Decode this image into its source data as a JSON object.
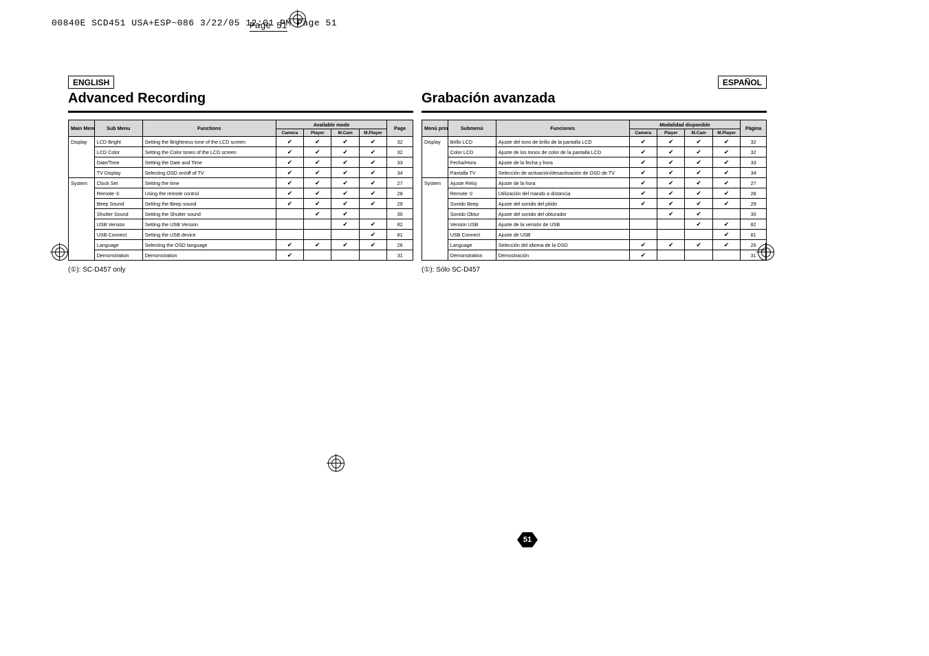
{
  "print_header": "00840E SCD451 USA+ESP~086  3/22/05 12:01 PM  Page 51",
  "page_label": "Page 51",
  "page_number": "51",
  "english": {
    "lang": "ENGLISH",
    "title": "Advanced Recording",
    "headers": {
      "main": "Main Menu",
      "sub": "Sub Menu",
      "func": "Functions",
      "avail": "Available mode",
      "modes": [
        "Camera",
        "Player",
        "M.Cam",
        "M.Player"
      ],
      "page": "Page"
    },
    "groups": [
      {
        "main": "Display",
        "rows": [
          {
            "sub": "LCD Bright",
            "func": "Setting the Brightness tone of the LCD screen",
            "m": [
              "✔",
              "✔",
              "✔",
              "✔"
            ],
            "p": "32"
          },
          {
            "sub": "LCD Color",
            "func": "Setting the Color tones of the LCD screen",
            "m": [
              "✔",
              "✔",
              "✔",
              "✔"
            ],
            "p": "32"
          },
          {
            "sub": "Date/Time",
            "func": "Setting the Date and Time",
            "m": [
              "✔",
              "✔",
              "✔",
              "✔"
            ],
            "p": "33"
          },
          {
            "sub": "TV Display",
            "func": "Selecting OSD on/off of TV",
            "m": [
              "✔",
              "✔",
              "✔",
              "✔"
            ],
            "p": "34"
          }
        ]
      },
      {
        "main": "System",
        "rows": [
          {
            "sub": "Clock Set",
            "func": "Setting the time",
            "m": [
              "✔",
              "✔",
              "✔",
              "✔"
            ],
            "p": "27"
          },
          {
            "sub": "Remote ①",
            "func": "Using the remote control",
            "m": [
              "✔",
              "✔",
              "✔",
              "✔"
            ],
            "p": "28"
          },
          {
            "sub": "Beep Sound",
            "func": "Setting the Beep sound",
            "m": [
              "✔",
              "✔",
              "✔",
              "✔"
            ],
            "p": "29"
          },
          {
            "sub": "Shutter Sound",
            "func": "Setting the Shutter sound",
            "m": [
              "",
              "✔",
              "✔",
              ""
            ],
            "p": "30"
          },
          {
            "sub": "USB Version",
            "func": "Setting the USB Version",
            "m": [
              "",
              "",
              "✔",
              "✔"
            ],
            "p": "82"
          },
          {
            "sub": "USB Connect",
            "func": "Setting the USB device",
            "m": [
              "",
              "",
              "",
              "✔"
            ],
            "p": "81"
          },
          {
            "sub": "Language",
            "func": "Selecting the OSD language",
            "m": [
              "✔",
              "✔",
              "✔",
              "✔"
            ],
            "p": "26"
          },
          {
            "sub": "Demonstration",
            "func": "Demonstration",
            "m": [
              "✔",
              "",
              "",
              ""
            ],
            "p": "31"
          }
        ]
      }
    ],
    "note_prefix": "(①): ",
    "note": "SC-D457 only"
  },
  "spanish": {
    "lang": "ESPAÑOL",
    "title": "Grabación avanzada",
    "headers": {
      "main": "Menú principal",
      "sub": "Submenú",
      "func": "Funciones",
      "avail": "Modalidad disponible",
      "modes": [
        "Camera",
        "Player",
        "M.Cam",
        "M.Player"
      ],
      "page": "Página"
    },
    "groups": [
      {
        "main": "Display",
        "rows": [
          {
            "sub": "Brillo LCD",
            "func": "Ajuste del tono de brillo de la pantalla LCD",
            "m": [
              "✔",
              "✔",
              "✔",
              "✔"
            ],
            "p": "32"
          },
          {
            "sub": "Color LCD",
            "func": "Ajuste de los tonos de color de la pantalla LCD",
            "m": [
              "✔",
              "✔",
              "✔",
              "✔"
            ],
            "p": "32"
          },
          {
            "sub": "Fecha/Hora",
            "func": "Ajuste de la fecha y hora",
            "m": [
              "✔",
              "✔",
              "✔",
              "✔"
            ],
            "p": "33"
          },
          {
            "sub": "Pantalla TV",
            "func": "Selección de activación/desactivación de OSD de TV",
            "m": [
              "✔",
              "✔",
              "✔",
              "✔"
            ],
            "p": "34"
          }
        ]
      },
      {
        "main": "System",
        "rows": [
          {
            "sub": "Ajuste Reloj",
            "func": "Ajuste de la hora",
            "m": [
              "✔",
              "✔",
              "✔",
              "✔"
            ],
            "p": "27"
          },
          {
            "sub": "Remote ①",
            "func": "Utilización del mando a distancia",
            "m": [
              "✔",
              "✔",
              "✔",
              "✔"
            ],
            "p": "28"
          },
          {
            "sub": "Sonido Beep",
            "func": "Ajuste del sonido del pitido",
            "m": [
              "✔",
              "✔",
              "✔",
              "✔"
            ],
            "p": "29"
          },
          {
            "sub": "Sonido Obtur",
            "func": "Ajuste del sonido del obturador",
            "m": [
              "",
              "✔",
              "✔",
              ""
            ],
            "p": "30"
          },
          {
            "sub": "Versión USB",
            "func": "Ajuste de la versión de USB",
            "m": [
              "",
              "",
              "✔",
              "✔"
            ],
            "p": "82"
          },
          {
            "sub": "USB Connect",
            "func": "Ajuste de USB",
            "m": [
              "",
              "",
              "",
              "✔"
            ],
            "p": "81"
          },
          {
            "sub": "Language",
            "func": "Selección del idioma de la OSD",
            "m": [
              "✔",
              "✔",
              "✔",
              "✔"
            ],
            "p": "26"
          },
          {
            "sub": "Demonstration",
            "func": "Demostración",
            "m": [
              "✔",
              "",
              "",
              ""
            ],
            "p": "31"
          }
        ]
      }
    ],
    "note_prefix": "(①): ",
    "note": "Sólo SC-D457"
  }
}
